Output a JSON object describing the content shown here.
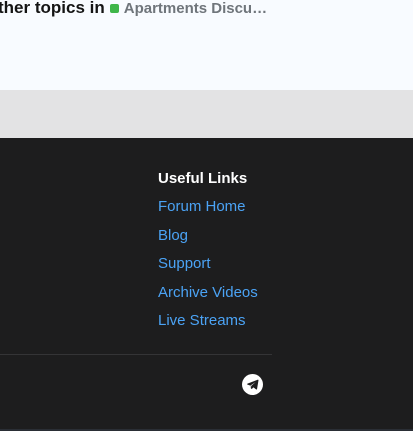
{
  "topics": {
    "prefix": "ther topics in",
    "category": "Apartments Discu…",
    "status_color": "#3fb64a"
  },
  "footer": {
    "useful_links": {
      "heading": "Useful Links",
      "items": [
        {
          "label": "Forum Home"
        },
        {
          "label": "Blog"
        },
        {
          "label": "Support"
        },
        {
          "label": "Archive Videos"
        },
        {
          "label": "Live Streams"
        }
      ]
    },
    "social": {
      "icon": "telegram-icon"
    }
  },
  "colors": {
    "link": "#4ba3f5",
    "footer_bg": "#1d1d1e",
    "card_bg": "#f8fbff"
  }
}
